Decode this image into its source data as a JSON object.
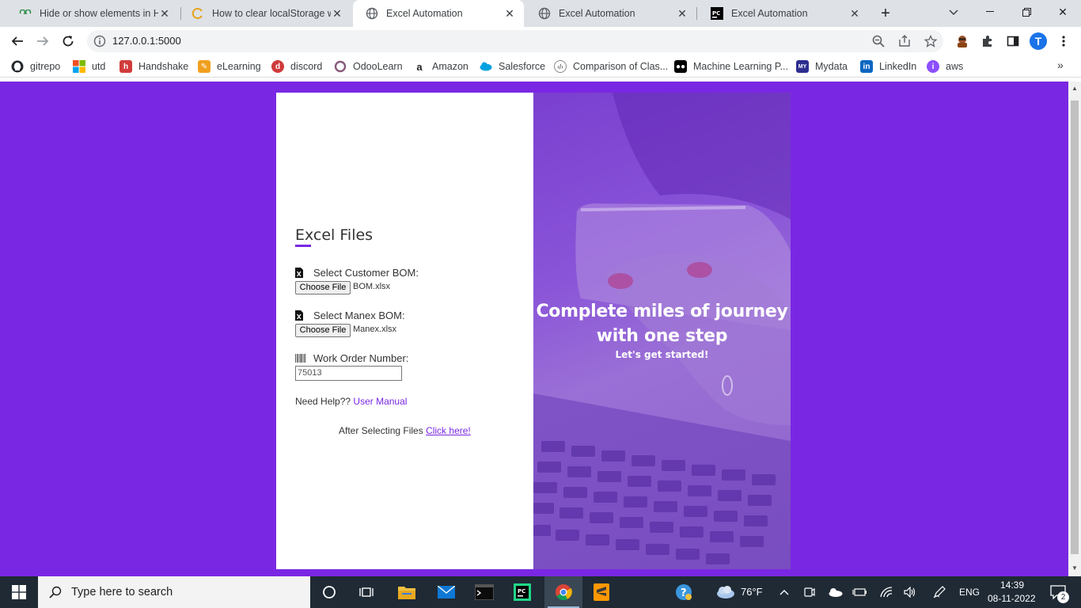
{
  "browser": {
    "tabs": [
      {
        "title": "Hide or show elements in HT",
        "favicon": "geeks-icon"
      },
      {
        "title": "How to clear localStorage wh",
        "favicon": "loading-icon"
      },
      {
        "title": "Excel Automation",
        "favicon": "globe-icon"
      },
      {
        "title": "Excel Automation",
        "favicon": "globe-icon"
      },
      {
        "title": "Excel Automation",
        "favicon": "pycharm-icon"
      }
    ],
    "active_tab_index": 2,
    "url": "127.0.0.1:5000",
    "bookmarks": [
      {
        "label": "gitrepo",
        "icon": "github-icon",
        "color": "#24292e"
      },
      {
        "label": "utd",
        "icon": "windows-icon",
        "color": "#f25022"
      },
      {
        "label": "Handshake",
        "icon": "handshake-icon",
        "color": "#d13b3b"
      },
      {
        "label": "eLearning",
        "icon": "pencil-icon",
        "color": "#f0a020"
      },
      {
        "label": "discord",
        "icon": "discord-icon",
        "color": "#d03a3a"
      },
      {
        "label": "OdooLearn",
        "icon": "odoo-icon",
        "color": "#875a7b"
      },
      {
        "label": "Amazon",
        "icon": "amazon-icon",
        "color": "#222222"
      },
      {
        "label": "Salesforce",
        "icon": "cloud-icon",
        "color": "#00a1e0"
      },
      {
        "label": "Comparison of Clas...",
        "icon": "code-icon",
        "color": "#888888"
      },
      {
        "label": "Machine Learning P...",
        "icon": "medium-icon",
        "color": "#000000"
      },
      {
        "label": "Mydata",
        "icon": "mydata-icon",
        "color": "#2d2d8f"
      },
      {
        "label": "LinkedIn",
        "icon": "linkedin-icon",
        "color": "#0a66c2"
      },
      {
        "label": "aws",
        "icon": "aws-icon",
        "color": "#8c4fff"
      }
    ],
    "profile_initial": "T"
  },
  "page": {
    "background_color": "#7a27e3",
    "form": {
      "title": "Excel Files",
      "customer_bom_label": "Select Customer BOM:",
      "customer_bom_button": "Choose File",
      "customer_bom_file": "BOM.xlsx",
      "manex_bom_label": "Select Manex BOM:",
      "manex_bom_button": "Choose File",
      "manex_bom_file": "Manex.xlsx",
      "work_order_label": "Work Order Number:",
      "work_order_value": "75013",
      "help_text": "Need Help??",
      "help_link": "User Manual",
      "after_text": "After Selecting Files",
      "after_link": "Click here!"
    },
    "hero": {
      "title": "Complete miles of journey with one step",
      "subtitle": "Let's get started!"
    }
  },
  "taskbar": {
    "search_placeholder": "Type here to search",
    "weather": "76°F",
    "language": "ENG",
    "time": "14:39",
    "date": "08-11-2022",
    "notification_count": "2"
  }
}
